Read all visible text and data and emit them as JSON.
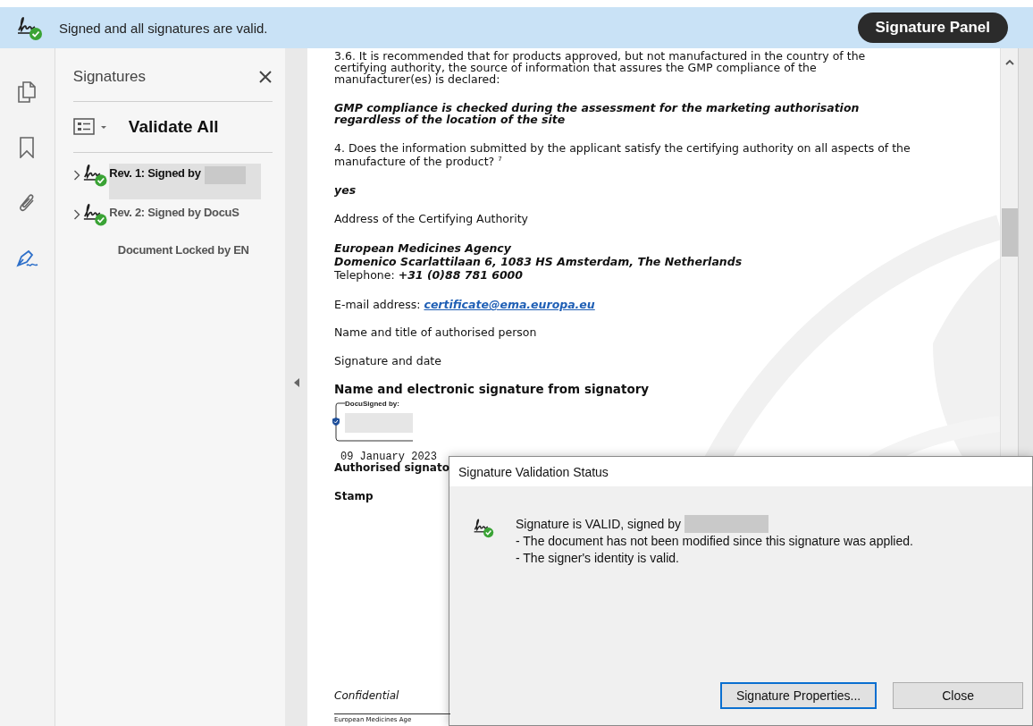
{
  "status_bar": {
    "valid": true,
    "message": "Signed and all signatures are valid.",
    "panel_button": "Signature Panel"
  },
  "rail": [
    {
      "kind": "pages",
      "selected": false
    },
    {
      "kind": "bookmarks",
      "selected": false
    },
    {
      "kind": "attachments",
      "selected": false
    },
    {
      "kind": "signatures",
      "selected": true
    }
  ],
  "signatures_panel": {
    "title": "Signatures",
    "validate_all": "Validate All",
    "items": [
      {
        "label": "Rev. 1: Signed by",
        "selected": true,
        "expanded": false,
        "valid": true,
        "redacted": true
      },
      {
        "label": "Rev. 2: Signed by DocuS",
        "selected": false,
        "expanded": false,
        "valid": true,
        "redacted": false
      }
    ],
    "lock_note": "Document Locked by EN"
  },
  "document": {
    "blocks": [
      {
        "kind": "text",
        "text": "3.6. It is recommended that for products approved, but not manufactured in the country of the certifying authority, the source of information that assures the GMP compliance of the manufacturer(es) is declared:"
      },
      {
        "kind": "emphasis",
        "text": "GMP compliance is checked during the assessment for the marketing authorisation regardless of the location of the site"
      },
      {
        "kind": "text",
        "text": "4. Does the information submitted by the applicant satisfy the certifying authority on all aspects of the manufacture of the product? $^{7}$"
      },
      {
        "kind": "emphasis",
        "text": "yes"
      },
      {
        "kind": "text",
        "text": "Address of the Certifying Authority"
      },
      {
        "kind": "address",
        "lines": [
          "**European Medicines Agency**",
          "**Domenico Scarlattilaan 6, 1083 HS Amsterdam, The Netherlands**",
          "Telephone: **+31 (0)88 781 6000**"
        ]
      },
      {
        "kind": "email",
        "label": "E-mail address:",
        "link": "certificate@ema.europa.eu"
      },
      {
        "kind": "text",
        "text": "Name and title of authorised person"
      },
      {
        "kind": "text",
        "text": "Signature and date"
      },
      {
        "kind": "heading",
        "text": "Name and electronic signature from signatory"
      }
    ],
    "signature_stamp": {
      "label": "DocuSigned by:",
      "redacted": true,
      "date": "09 January 2023"
    },
    "caption": "Authorised signato",
    "stamp": "Stamp",
    "confidential": "Confidential",
    "footer": "European Medicines Age"
  },
  "dialog": {
    "title": "Signature Validation Status",
    "valid": true,
    "summary": "Signature is VALID, signed by",
    "redacted": true,
    "details": [
      "- The document has not been modified since this signature was applied.",
      "- The signer's identity is valid."
    ],
    "buttons": [
      {
        "label": "Signature Properties...",
        "focused": true
      },
      {
        "label": "Close",
        "focused": false
      }
    ]
  }
}
